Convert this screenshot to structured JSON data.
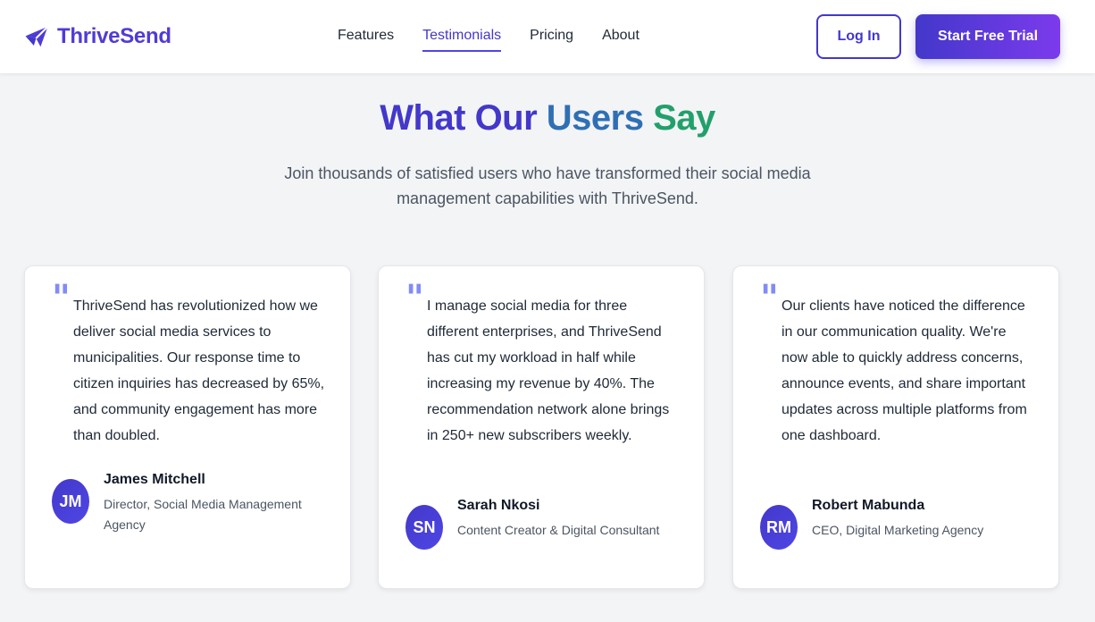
{
  "brand": {
    "name": "ThriveSend",
    "icon": "paper-plane-icon",
    "color": "#4f3bd6"
  },
  "nav": {
    "items": [
      {
        "label": "Features",
        "active": false
      },
      {
        "label": "Testimonials",
        "active": true
      },
      {
        "label": "Pricing",
        "active": false
      },
      {
        "label": "About",
        "active": false
      }
    ]
  },
  "actions": {
    "login_label": "Log In",
    "trial_label": "Start Free Trial"
  },
  "section": {
    "title_parts": [
      "What Our ",
      "Users ",
      "Say"
    ],
    "subtitle": "Join thousands of satisfied users who have transformed their social media management capabilities with ThriveSend."
  },
  "testimonials": [
    {
      "quote": "ThriveSend has revolutionized how we deliver social media services to municipalities. Our response time to citizen inquiries has decreased by 65%, and community engagement has more than doubled.",
      "initials": "JM",
      "name": "James Mitchell",
      "role": "Director, Social Media Management Agency"
    },
    {
      "quote": "I manage social media for three different enterprises, and ThriveSend has cut my workload in half while increasing my revenue by 40%. The recommendation network alone brings in 250+ new subscribers weekly.",
      "initials": "SN",
      "name": "Sarah Nkosi",
      "role": "Content Creator & Digital Consultant"
    },
    {
      "quote": "Our clients have noticed the difference in our communication quality. We're now able to quickly address concerns, announce events, and share important updates across multiple platforms from one dashboard.",
      "initials": "RM",
      "name": "Robert Mabunda",
      "role": "CEO, Digital Marketing Agency"
    }
  ],
  "colors": {
    "accent": "#4338ca",
    "title_gradient": [
      "#4338ca",
      "#2f6fb4",
      "#22a06b"
    ],
    "quote_mark": "#818cf8"
  }
}
